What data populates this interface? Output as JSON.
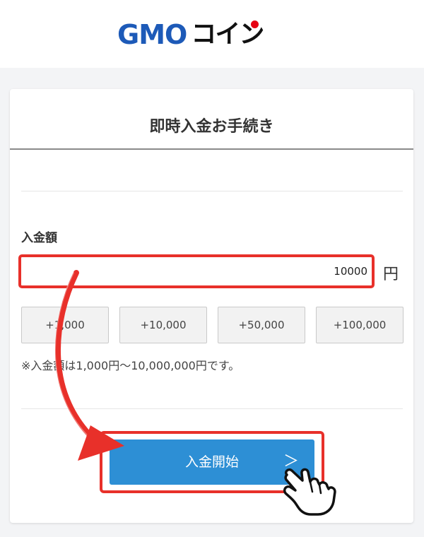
{
  "header": {
    "logo_gmo": "GMO",
    "logo_coin": "コイン"
  },
  "card": {
    "title": "即時入金お手続き",
    "amount_label": "入金額",
    "amount_value": "10000",
    "unit": "円",
    "quick_buttons": [
      "+1,000",
      "+10,000",
      "+50,000",
      "+100,000"
    ],
    "note": "※入金額は1,000円〜10,000,000円です。",
    "start_label": "入金開始",
    "start_chevron": "＞"
  },
  "colors": {
    "brand_blue": "#1d5ab8",
    "logo_red_dot": "#e60012",
    "highlight_red": "#e8302a",
    "button_blue": "#2d8fd5"
  },
  "icons": {
    "arrow": "red-curved-arrow-icon",
    "pointer": "hand-pointer-icon"
  }
}
